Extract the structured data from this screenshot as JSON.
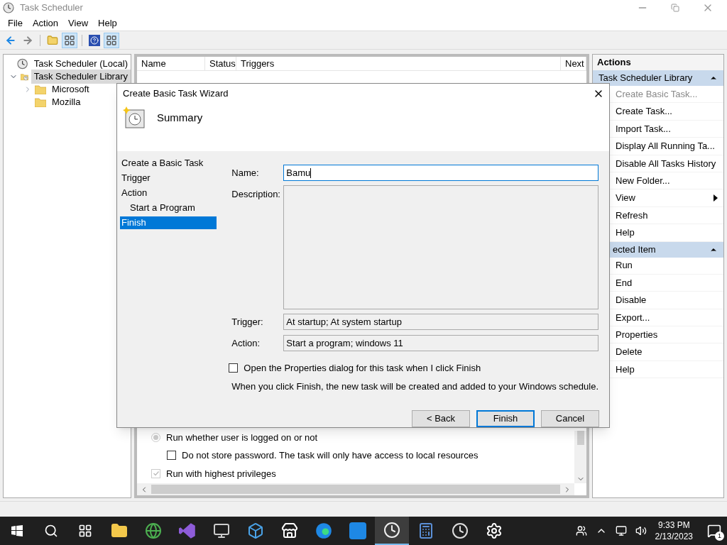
{
  "window": {
    "title": "Task Scheduler"
  },
  "menu": [
    "File",
    "Action",
    "View",
    "Help"
  ],
  "tree": [
    {
      "label": "Task Scheduler (Local)",
      "kind": "root",
      "selected": false,
      "children": [
        {
          "label": "Task Scheduler Library",
          "kind": "library",
          "expanded": true,
          "selected": true,
          "children": [
            {
              "label": "Microsoft",
              "kind": "folder",
              "expanded": false,
              "selected": false
            },
            {
              "label": "Mozilla",
              "kind": "folder",
              "selected": false
            }
          ]
        }
      ]
    }
  ],
  "task_list": {
    "columns": [
      "Name",
      "Status",
      "Triggers",
      "Next"
    ]
  },
  "security_options": [
    {
      "kind": "radio",
      "label": "Run whether user is logged on or not",
      "checked": true,
      "disabled": true,
      "indented": false
    },
    {
      "kind": "checkbox",
      "label": "Do not store password.  The task will only have access to local resources",
      "checked": false,
      "disabled": false,
      "indented": true
    },
    {
      "kind": "checkbox",
      "label": "Run with highest privileges",
      "checked": true,
      "disabled": true,
      "indented": false
    }
  ],
  "actions": {
    "title": "Actions",
    "sections": [
      {
        "header": "Task Scheduler Library",
        "items": [
          {
            "label": "Create Basic Task...",
            "kind": "item",
            "disabled": true
          },
          {
            "label": "Create Task...",
            "kind": "item",
            "disabled": false
          },
          {
            "label": "Import Task...",
            "kind": "item",
            "disabled": false
          },
          {
            "label": "Display All Running Ta...",
            "kind": "item",
            "disabled": false
          },
          {
            "label": "Disable All Tasks History",
            "kind": "item",
            "disabled": false
          },
          {
            "label": "New Folder...",
            "kind": "item",
            "disabled": false
          },
          {
            "label": "View",
            "kind": "submenu",
            "disabled": false
          },
          {
            "label": "Refresh",
            "kind": "item",
            "disabled": false
          },
          {
            "label": "Help",
            "kind": "item",
            "disabled": false
          }
        ]
      },
      {
        "header": "ected Item",
        "items": [
          {
            "label": "Run",
            "kind": "item",
            "disabled": false
          },
          {
            "label": "End",
            "kind": "item",
            "disabled": false
          },
          {
            "label": "Disable",
            "kind": "item",
            "disabled": false
          },
          {
            "label": "Export...",
            "kind": "item",
            "disabled": false
          },
          {
            "label": "Properties",
            "kind": "item",
            "disabled": false
          },
          {
            "label": "Delete",
            "kind": "item",
            "disabled": false
          },
          {
            "label": "Help",
            "kind": "item",
            "disabled": false
          }
        ]
      }
    ]
  },
  "wizard": {
    "title": "Create Basic Task Wizard",
    "heading": "Summary",
    "steps": [
      {
        "label": "Create a Basic Task",
        "selected": false
      },
      {
        "label": "Trigger",
        "selected": false
      },
      {
        "label": "Action",
        "selected": false,
        "children": [
          {
            "label": "Start a Program",
            "selected": false
          }
        ]
      },
      {
        "label": "Finish",
        "selected": true
      }
    ],
    "name_label": "Name:",
    "name_value": "Bamu",
    "description_label": "Description:",
    "trigger_label": "Trigger:",
    "trigger_value": "At startup; At system startup",
    "action_label": "Action:",
    "action_value": "Start a program; windows 11",
    "open_properties": {
      "label": "Open the Properties dialog for this task when I click Finish",
      "checked": false
    },
    "note": "When you click Finish, the new task will be created and added to your Windows schedule.",
    "buttons": [
      {
        "label": "< Back",
        "default": false
      },
      {
        "label": "Finish",
        "default": true
      },
      {
        "label": "Cancel",
        "default": false
      }
    ]
  },
  "taskbar": {
    "time": "9:33 PM",
    "date": "2/13/2023",
    "notifications": "1"
  }
}
